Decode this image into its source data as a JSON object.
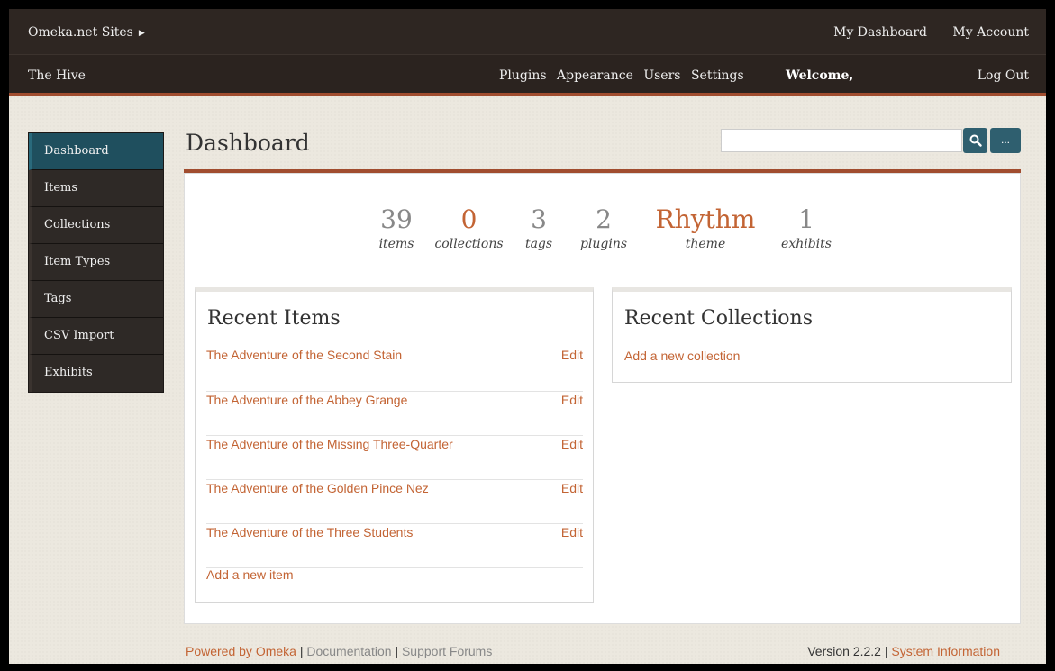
{
  "topbar": {
    "sites_label": "Omeka.net Sites",
    "my_dashboard": "My Dashboard",
    "my_account": "My Account"
  },
  "secondbar": {
    "site_name": "The Hive",
    "nav": [
      "Plugins",
      "Appearance",
      "Users",
      "Settings"
    ],
    "welcome": "Welcome,",
    "logout": "Log Out"
  },
  "sidebar": {
    "items": [
      {
        "label": "Dashboard",
        "active": true
      },
      {
        "label": "Items"
      },
      {
        "label": "Collections"
      },
      {
        "label": "Item Types"
      },
      {
        "label": "Tags"
      },
      {
        "label": "CSV Import"
      },
      {
        "label": "Exhibits"
      }
    ]
  },
  "page": {
    "title": "Dashboard",
    "search_value": "",
    "more_label": "..."
  },
  "stats": [
    {
      "value": "39",
      "label": "items"
    },
    {
      "value": "0",
      "label": "collections"
    },
    {
      "value": "3",
      "label": "tags"
    },
    {
      "value": "2",
      "label": "plugins"
    },
    {
      "value": "Rhythm",
      "label": "theme"
    },
    {
      "value": "1",
      "label": "exhibits"
    }
  ],
  "recent_items": {
    "heading": "Recent Items",
    "items": [
      {
        "title": "The Adventure of the Second Stain",
        "edit": "Edit"
      },
      {
        "title": "The Adventure of the Abbey Grange",
        "edit": "Edit"
      },
      {
        "title": "The Adventure of the Missing Three-Quarter",
        "edit": "Edit"
      },
      {
        "title": "The Adventure of the Golden Pince Nez",
        "edit": "Edit"
      },
      {
        "title": "The Adventure of the Three Students",
        "edit": "Edit"
      }
    ],
    "add_label": "Add a new item"
  },
  "recent_collections": {
    "heading": "Recent Collections",
    "add_label": "Add a new collection"
  },
  "footer": {
    "powered_by": "Powered by Omeka",
    "documentation": "Documentation",
    "support": "Support Forums",
    "version": "Version 2.2.2",
    "system_info": "System Information",
    "separator": "|"
  },
  "colors": {
    "accent": "#c36434",
    "rule": "#a14d2f",
    "active_nav": "#1f4f5e",
    "header_bg": "#2e2622"
  }
}
